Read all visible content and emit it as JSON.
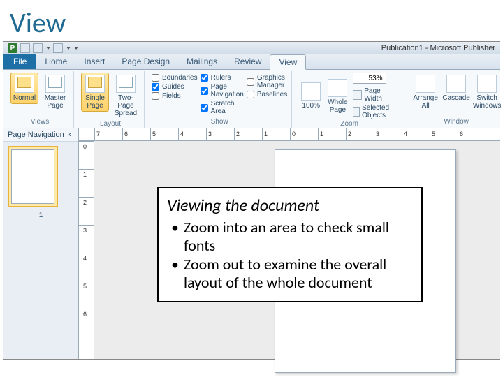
{
  "slide": {
    "title": "View"
  },
  "window": {
    "p": "P",
    "title": "Publication1 - Microsoft Publisher"
  },
  "tabs": {
    "file": "File",
    "items": [
      "Home",
      "Insert",
      "Page Design",
      "Mailings",
      "Review",
      "View"
    ],
    "active": "View"
  },
  "ribbon": {
    "views": {
      "name": "Views",
      "buttons": [
        {
          "label": "Normal"
        },
        {
          "label": "Master Page"
        }
      ]
    },
    "layout": {
      "name": "Layout",
      "buttons": [
        {
          "label": "Single Page"
        },
        {
          "label": "Two-Page Spread"
        }
      ]
    },
    "show": {
      "name": "Show",
      "col1": [
        {
          "label": "Boundaries",
          "checked": false
        },
        {
          "label": "Guides",
          "checked": true
        },
        {
          "label": "Fields",
          "checked": false
        }
      ],
      "col2": [
        {
          "label": "Rulers",
          "checked": true
        },
        {
          "label": "Page Navigation",
          "checked": true
        },
        {
          "label": "Scratch Area",
          "checked": true
        }
      ],
      "col3": [
        {
          "label": "Graphics Manager",
          "checked": false
        },
        {
          "label": "Baselines",
          "checked": false
        }
      ]
    },
    "zoom": {
      "name": "Zoom",
      "hundred": "100%",
      "whole": "Whole Page",
      "value": "53%",
      "pagewidth": "Page Width",
      "selobj": "Selected Objects"
    },
    "window_group": {
      "name": "Window",
      "arrange": "Arrange All",
      "cascade": "Cascade",
      "switch": "Switch Windows"
    }
  },
  "nav": {
    "title": "Page Navigation",
    "collapse": "‹",
    "thumb_num": "1"
  },
  "hruler": [
    "7",
    "6",
    "5",
    "4",
    "3",
    "2",
    "1",
    "0",
    "1",
    "2",
    "3",
    "4",
    "5",
    "6"
  ],
  "vruler": [
    "0",
    "1",
    "2",
    "3",
    "4",
    "5",
    "6"
  ],
  "overlay": {
    "heading": "Viewing the document",
    "bullets": [
      "Zoom into an area to check small fonts",
      "Zoom out to examine the overall layout of the whole document"
    ]
  }
}
